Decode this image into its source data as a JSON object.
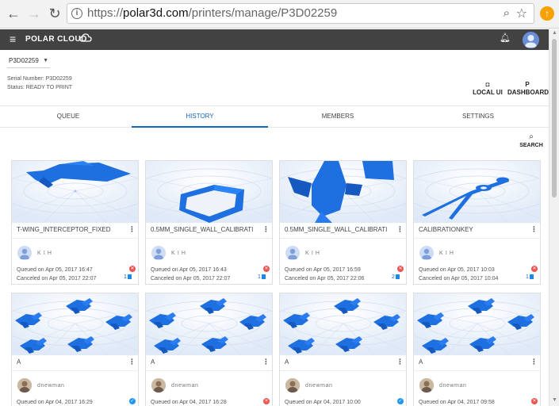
{
  "browser": {
    "url_scheme": "https://",
    "url_host": "polar3d.com",
    "url_path": "/printers/manage/P3D02259"
  },
  "appbar": {
    "brand": "POLAR CLOUD"
  },
  "printer": {
    "selected": "P3D02259",
    "serial": "Serial Number: P3D02259",
    "status": "Status: READY TO PRINT"
  },
  "actions": {
    "local_ui_icon": "◘",
    "local_ui": "LOCAL UI",
    "dashboard_icon": "P",
    "dashboard": "DASHBOARD",
    "search": "SEARCH"
  },
  "tabs": [
    {
      "label": "QUEUE"
    },
    {
      "label": "HISTORY"
    },
    {
      "label": "MEMBERS"
    },
    {
      "label": "SETTINGS"
    }
  ],
  "jobs": [
    {
      "title": "T-WING_INTERCEPTOR_FIXED",
      "user": "K I H",
      "queued": "Queued on Apr 05, 2017 16:47",
      "canceled": "Canceled on Apr 05, 2017 22:07",
      "copies": "1"
    },
    {
      "title": "0.5MM_SINGLE_WALL_CALIBRATI",
      "user": "K I H",
      "queued": "Queued on Apr 05, 2017 16:43",
      "canceled": "Canceled on Apr 05, 2017 22:07",
      "copies": "1"
    },
    {
      "title": "0.5MM_SINGLE_WALL_CALIBRATI",
      "user": "K I H",
      "queued": "Queued on Apr 05, 2017 16:59",
      "canceled": "Canceled on Apr 05, 2017 22:06",
      "copies": "2"
    },
    {
      "title": "CALIBRATIONKEY",
      "user": "K I H",
      "queued": "Queued on Apr 05, 2017 10:03",
      "canceled": "Canceled on Apr 05, 2017 10:04",
      "copies": "1"
    },
    {
      "title": "A",
      "user": "dnewman",
      "queued": "Queued on Apr 04, 2017 16:29"
    },
    {
      "title": "A",
      "user": "dnewman",
      "queued": "Queued on Apr 04, 2017 16:28"
    },
    {
      "title": "A",
      "user": "dnewman",
      "queued": "Queued on Apr 04, 2017 10:00"
    },
    {
      "title": "A",
      "user": "dnewman",
      "queued": "Queued on Apr 04, 2017 09:58"
    }
  ],
  "colors": {
    "accent": "#1565c0",
    "model_blue": "#1e6fe0",
    "appbar": "#424242",
    "error": "#ef5350"
  }
}
